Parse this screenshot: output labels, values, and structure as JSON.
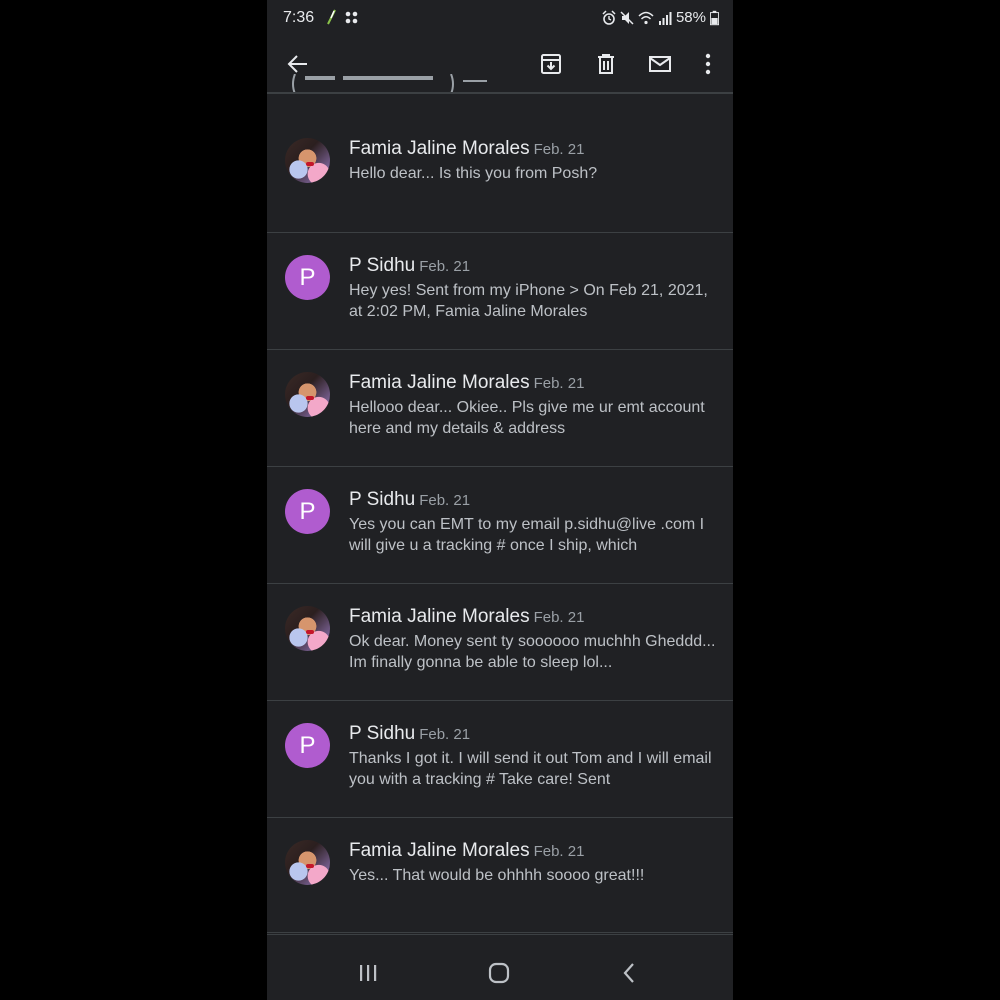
{
  "status_bar": {
    "time": "7:36",
    "battery": "58%",
    "icons": [
      "leaf-icon",
      "grid-icon",
      "alarm-icon",
      "mute-icon",
      "wifi-icon",
      "signal-icon",
      "battery-icon"
    ]
  },
  "toolbar": {
    "icons": [
      "back-arrow-icon",
      "archive-icon",
      "delete-icon",
      "mark-unread-icon",
      "more-options-icon"
    ]
  },
  "messages": [
    {
      "sender": "Famia Jaline Morales",
      "date": "Feb. 21",
      "avatar": "photo",
      "snippet": "Hello dear... Is this you from Posh?"
    },
    {
      "sender": "P Sidhu",
      "date": "Feb. 21",
      "avatar": "letter",
      "avatar_letter": "P",
      "snippet": "Hey yes! Sent from my iPhone > On Feb 21, 2021, at 2:02 PM, Famia Jaline Morales"
    },
    {
      "sender": "Famia Jaline Morales",
      "date": "Feb. 21",
      "avatar": "photo",
      "snippet": "Hellooo dear... Okiee.. Pls give me ur emt account here and my details & address"
    },
    {
      "sender": "P Sidhu",
      "date": "Feb. 21",
      "avatar": "letter",
      "avatar_letter": "P",
      "snippet": "Yes you can EMT to my email p.sidhu@live .com I will give u a tracking # once I ship, which"
    },
    {
      "sender": "Famia Jaline Morales",
      "date": "Feb. 21",
      "avatar": "photo",
      "snippet": "Ok dear. Money sent ty soooooo muchhh Gheddd... Im finally gonna be able to sleep lol..."
    },
    {
      "sender": "P Sidhu",
      "date": "Feb. 21",
      "avatar": "letter",
      "avatar_letter": "P",
      "snippet": "Thanks I got it. I will send it out Tom and I will email you with a tracking # Take care! Sent"
    },
    {
      "sender": "Famia Jaline Morales",
      "date": "Feb. 21",
      "avatar": "photo",
      "snippet": "Yes... That would be ohhhh soooo great!!!"
    }
  ],
  "nav_bar": {
    "icons": [
      "recent-apps-icon",
      "home-icon",
      "back-nav-icon"
    ]
  },
  "colors": {
    "background": "#202124",
    "text_primary": "#e8eaed",
    "text_secondary": "#bdc1c6",
    "avatar_letter_bg": "#b05ccf"
  }
}
